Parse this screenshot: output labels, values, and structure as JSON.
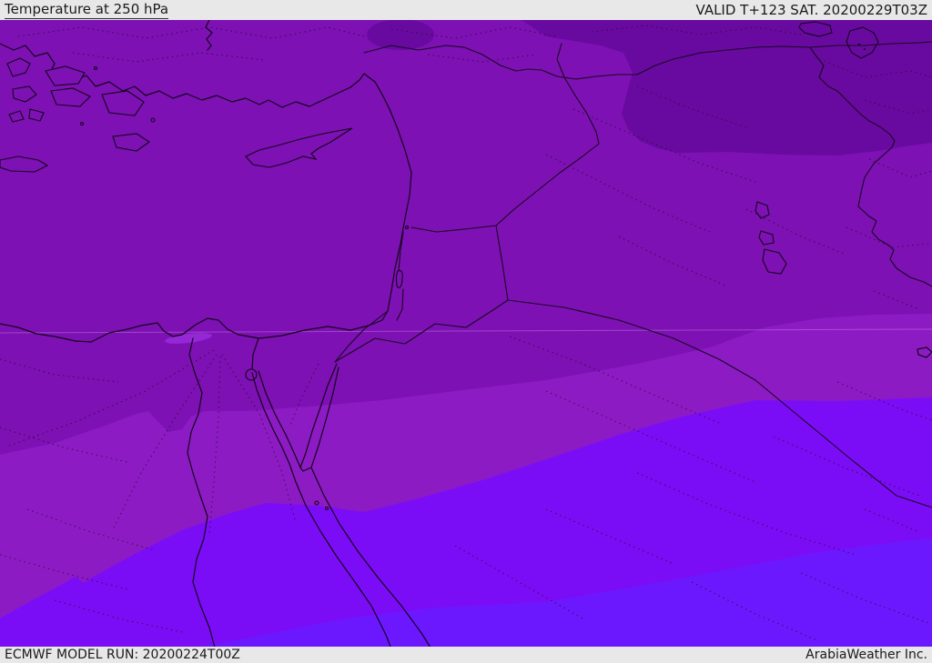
{
  "header": {
    "title": "Temperature at 250 hPa",
    "valid_label": "VALID T+123 SAT. 20200229T03Z"
  },
  "footer": {
    "model_run_label": "ECMWF MODEL RUN: 20200224T00Z",
    "credit_label": "ArabiaWeather Inc."
  },
  "map": {
    "parameter": "Temperature",
    "level": "250 hPa",
    "model": "ECMWF",
    "region": "Middle East / Eastern Mediterranean",
    "bands": [
      {
        "name": "coldest-dark-purple",
        "color": "#680AA0"
      },
      {
        "name": "very-cold-medium-purple",
        "color": "#7D11B4"
      },
      {
        "name": "cold-light-purple",
        "color": "#8C1BC4"
      },
      {
        "name": "mild-bright-violet",
        "color": "#7B0DF6"
      },
      {
        "name": "warmest-blue-violet",
        "color": "#6B18FF"
      }
    ],
    "accents": {
      "delta_warm_spot": "#9A2EE0",
      "chrome_bar_bg": "#E8E8E8",
      "chrome_bar_text": "#1A1A1A",
      "coastline": "#14051A"
    }
  }
}
